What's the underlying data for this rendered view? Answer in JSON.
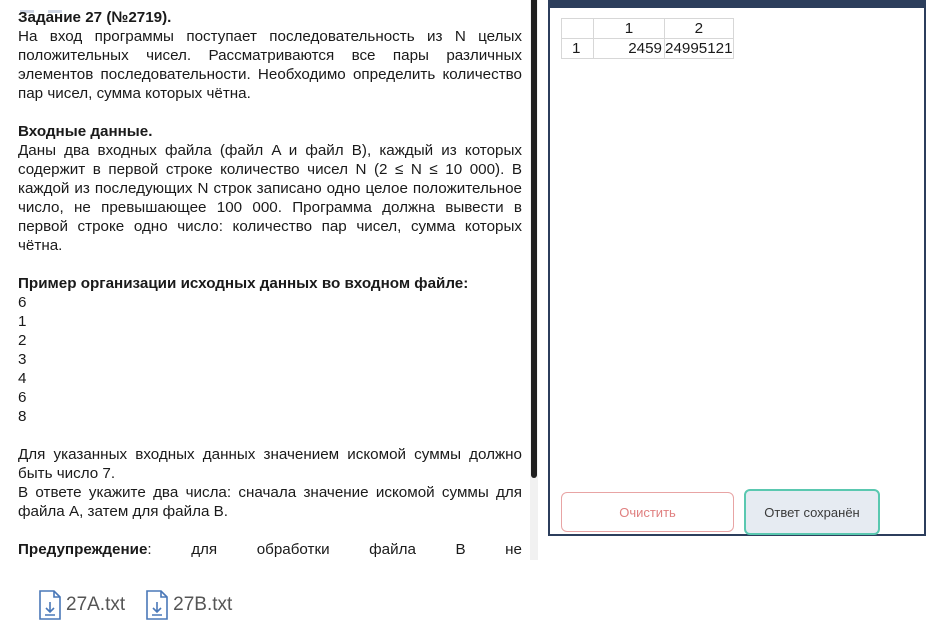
{
  "task": {
    "title": "Задание 27 (№2719).",
    "intro": "На вход программы поступает последовательность из N целых положительных чисел. Рассматриваются все пары различных элементов последовательности. Необходимо определить количество пар чисел, сумма которых чётна.",
    "input_heading": "Входные данные.",
    "input_text": "Даны два входных файла (файл A и файл B), каждый из которых содержит в первой строке количество чисел N (2 ≤ N ≤ 10 000). В каждой из последующих N строк записано одно целое положительное число, не превышающее 100 000. Программа должна вывести в первой строке одно число: количество пар чисел, сумма которых чётна.",
    "example_heading": "Пример организации исходных данных во входном файле:",
    "example_lines": [
      "6",
      "1",
      "2",
      "3",
      "4",
      "6",
      "8"
    ],
    "example_result": "Для указанных входных данных значением искомой суммы должно быть число 7.",
    "answer_instruction": "В ответе укажите два числа: сначала значение искомой суммы для файла A, затем для файла B.",
    "warning_label": "Предупреждение",
    "warning_tail": ": для обработки файла B не"
  },
  "answer": {
    "col_headers": [
      "1",
      "2"
    ],
    "row_label": "1",
    "values": [
      "2459",
      "24995121"
    ],
    "clear_button": "Очистить",
    "saved_button": "Ответ сохранён"
  },
  "files": [
    {
      "name": "27A.txt",
      "icon": "download-file-icon"
    },
    {
      "name": "27B.txt",
      "icon": "download-file-icon"
    }
  ],
  "colors": {
    "panel_border": "#2c3e5c",
    "clear_border": "#e8a4a4",
    "saved_border": "#5ac8b0",
    "saved_bg": "#e6ebf2"
  }
}
